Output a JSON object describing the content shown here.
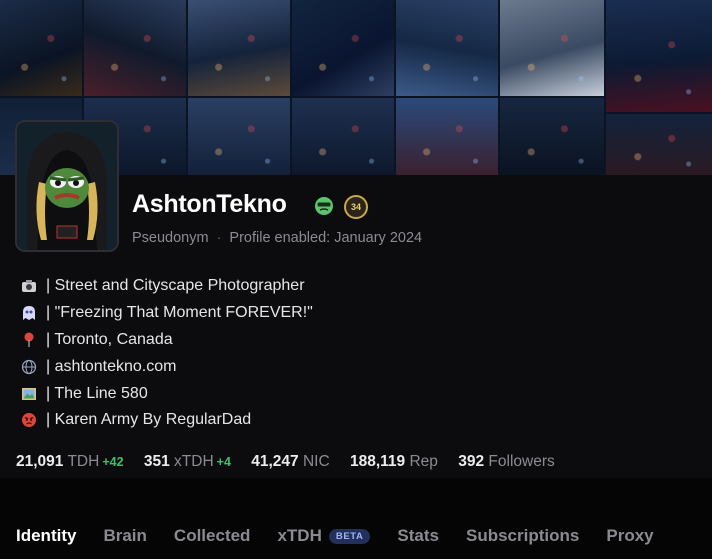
{
  "profile": {
    "name": "AshtonTekno",
    "level": "34",
    "classification": "Pseudonym",
    "separator": "·",
    "enabled": "Profile enabled: January 2024"
  },
  "bio": [
    {
      "icon": "camera-icon",
      "text": "| Street and Cityscape Photographer"
    },
    {
      "icon": "ghost-icon",
      "text": "| \"Freezing That Moment FOREVER!\""
    },
    {
      "icon": "pin-icon",
      "text": "| Toronto, Canada"
    },
    {
      "icon": "web-icon",
      "text": "| ashtontekno.com"
    },
    {
      "icon": "picture-icon",
      "text": "| The Line 580"
    },
    {
      "icon": "angry-face-icon",
      "text": "| Karen Army By RegularDad"
    }
  ],
  "stats": [
    {
      "value": "21,091",
      "unit": "TDH",
      "delta": "+42"
    },
    {
      "value": "351",
      "unit": "xTDH",
      "delta": "+4"
    },
    {
      "value": "41,247",
      "unit": "NIC",
      "delta": ""
    },
    {
      "value": "188,119",
      "unit": "Rep",
      "delta": ""
    },
    {
      "value": "392",
      "unit": "Followers",
      "delta": ""
    }
  ],
  "tabs": [
    {
      "label": "Identity",
      "active": true
    },
    {
      "label": "Brain"
    },
    {
      "label": "Collected"
    },
    {
      "label": "xTDH",
      "badge": "BETA"
    },
    {
      "label": "Stats"
    },
    {
      "label": "Subscriptions"
    },
    {
      "label": "Proxy"
    }
  ],
  "colors": {
    "background": "#0a0a0c",
    "positive_delta": "#3fbf6a",
    "level_badge": "#c9a94a",
    "beta_badge": "#23305a"
  }
}
